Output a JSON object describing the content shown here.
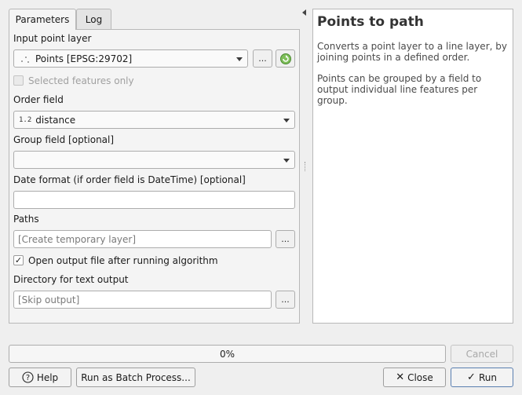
{
  "tabs": [
    {
      "label": "Parameters",
      "active": true
    },
    {
      "label": "Log",
      "active": false
    }
  ],
  "params": {
    "input_layer_label": "Input point layer",
    "input_layer_value": "Points [EPSG:29702]",
    "input_layer_browse": "...",
    "selected_only_label": "Selected features only",
    "order_field_label": "Order field",
    "order_field_type": "1.2",
    "order_field_value": "distance",
    "group_field_label": "Group field [optional]",
    "group_field_value": "",
    "date_format_label": "Date format (if order field is DateTime) [optional]",
    "date_format_value": "",
    "paths_label": "Paths",
    "paths_placeholder": "[Create temporary layer]",
    "paths_browse": "...",
    "open_output_label": "Open output file after running algorithm",
    "open_output_checked": true,
    "directory_label": "Directory for text output",
    "directory_placeholder": "[Skip output]",
    "directory_browse": "..."
  },
  "help": {
    "title": "Points to path",
    "para1": "Converts a point layer to a line layer, by joining points in a defined order.",
    "para2": "Points can be grouped by a field to output individual line features per group."
  },
  "progress": {
    "text": "0%",
    "value": 0
  },
  "buttons": {
    "cancel": "Cancel",
    "help": "Help",
    "batch": "Run as Batch Process...",
    "close": "Close",
    "run": "Run"
  },
  "icons": {
    "help": "question-circle-icon",
    "close": "x-icon",
    "run": "check-icon",
    "reload": "green-refresh-icon",
    "layer_type": "point-layer-icon"
  }
}
